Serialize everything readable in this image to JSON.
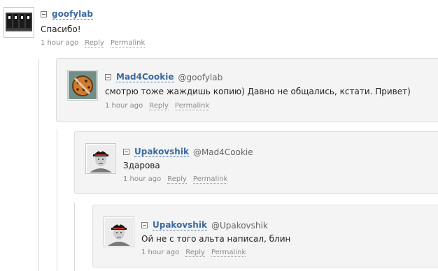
{
  "comments": [
    {
      "author": "goofylab",
      "reply_to": "",
      "text": "Спасибо!",
      "time": "1 hour ago",
      "reply_label": "Reply",
      "permalink_label": "Permalink"
    },
    {
      "author": "Mad4Cookie",
      "reply_to": "@goofylab",
      "text": "смотрю тоже жаждишь копию) Давно не общались, кстати. Привет)",
      "time": "1 hour ago",
      "reply_label": "Reply",
      "permalink_label": "Permalink"
    },
    {
      "author": "Upakovshik",
      "reply_to": "@Mad4Cookie",
      "text": "Здарова",
      "time": "1 hour ago",
      "reply_label": "Reply",
      "permalink_label": "Permalink"
    },
    {
      "author": "Upakovshik",
      "reply_to": "@Upakovshik",
      "text": "Ой не с того альта написал, блин",
      "time": "1 hour ago",
      "reply_label": "Reply",
      "permalink_label": "Permalink"
    }
  ]
}
